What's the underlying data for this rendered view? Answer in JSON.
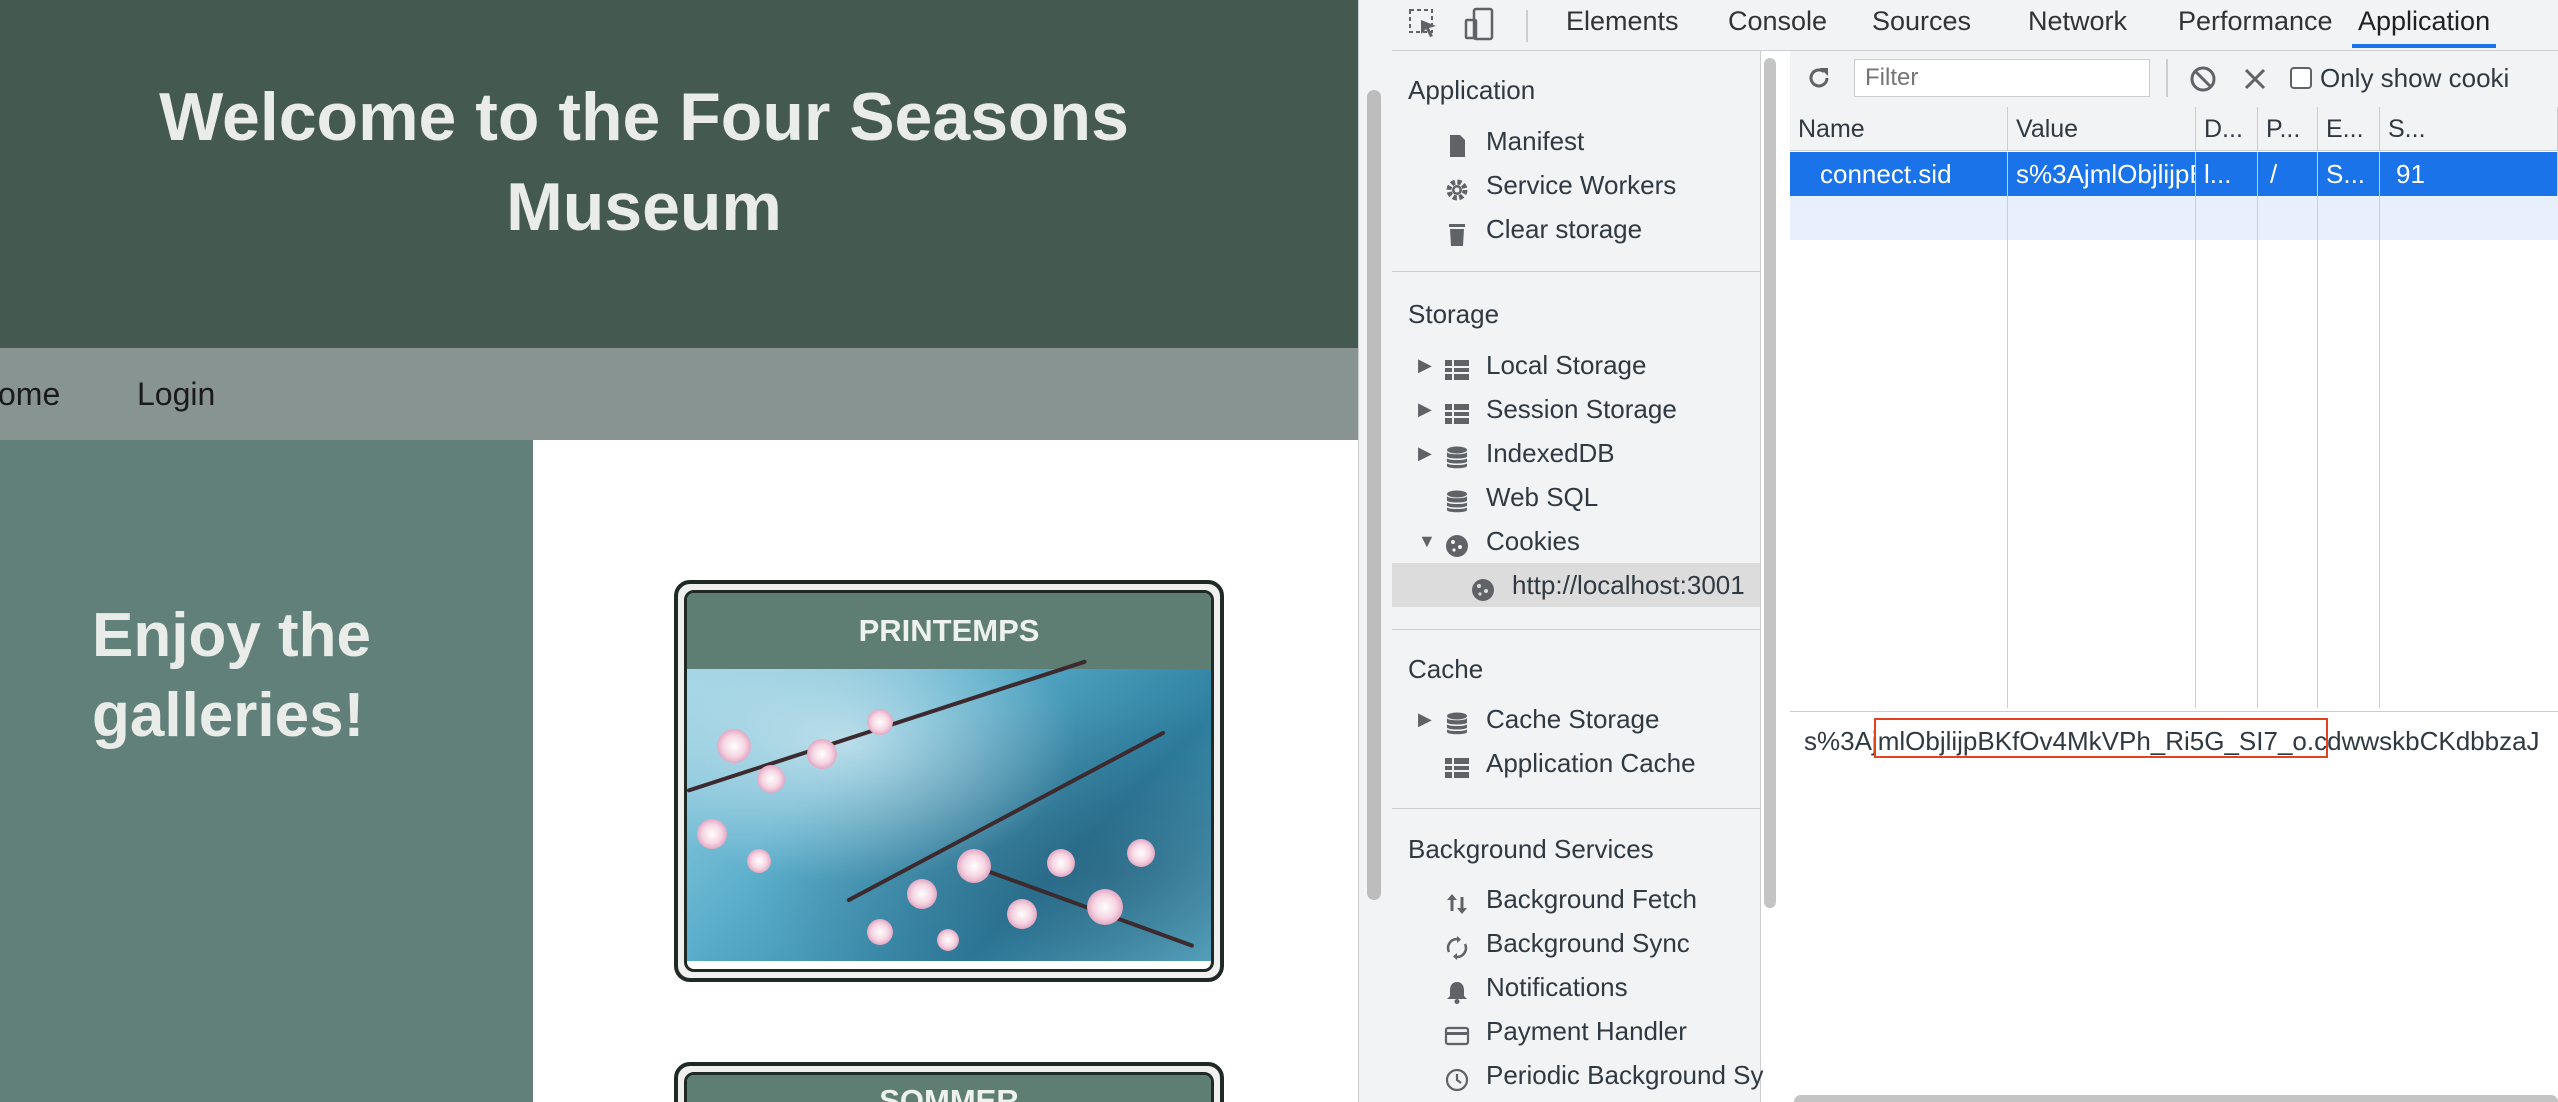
{
  "site": {
    "title": "Welcome to the Four Seasons Museum",
    "nav": [
      "ome",
      "Login"
    ],
    "aside_text": "Enjoy the galleries!",
    "cards": [
      "PRINTEMPS",
      "SOMMER"
    ]
  },
  "devtools": {
    "tabs": [
      "Elements",
      "Console",
      "Sources",
      "Network",
      "Performance",
      "Application"
    ],
    "active_tab": "Application",
    "sidebar": {
      "application_header": "Application",
      "application_items": [
        "Manifest",
        "Service Workers",
        "Clear storage"
      ],
      "storage_header": "Storage",
      "storage_items": [
        "Local Storage",
        "Session Storage",
        "IndexedDB",
        "Web SQL",
        "Cookies"
      ],
      "cookie_origin": "http://localhost:3001",
      "cache_header": "Cache",
      "cache_items": [
        "Cache Storage",
        "Application Cache"
      ],
      "background_header": "Background Services",
      "background_items": [
        "Background Fetch",
        "Background Sync",
        "Notifications",
        "Payment Handler",
        "Periodic Background Sy"
      ]
    },
    "cookies": {
      "filter_placeholder": "Filter",
      "only_show_label": "Only show cooki",
      "columns": [
        "Name",
        "Value",
        "D...",
        "P...",
        "E...",
        "S..."
      ],
      "row": {
        "name": "connect.sid",
        "value": "s%3AjmlObjlijpBKfOv...",
        "domain": "l...",
        "path": "/",
        "expires": "S...",
        "size": "91"
      },
      "value_prefix": "s%3A",
      "value_highlighted": "jmlObjlijpBKfOv4MkVPh_Ri5G_SI7_o",
      "value_suffix": ".cdwwskbCKdbbzaJ"
    },
    "colors": {
      "accent": "#1a73e8",
      "highlight": "#e2421e",
      "site_header": "#445a51",
      "site_aside": "#62807a"
    }
  }
}
